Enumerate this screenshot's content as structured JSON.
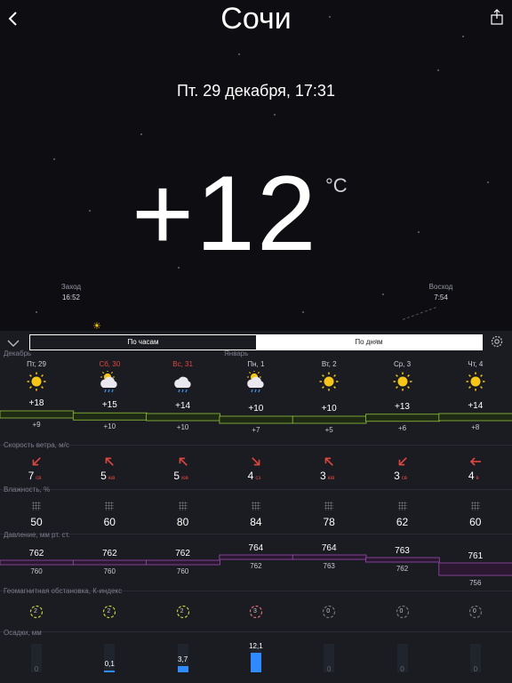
{
  "header": {
    "city": "Сочи",
    "datetime": "Пт. 29 декабря, 17:31",
    "temperature": "+12",
    "unit": "°C",
    "sunset_label": "Заход",
    "sunset_time": "16:52",
    "sunrise_label": "Восход",
    "sunrise_time": "7:54"
  },
  "tabs": {
    "hourly": "По часам",
    "daily": "По дням",
    "active": "hourly"
  },
  "months": {
    "first": "Декабрь",
    "second": "Январь"
  },
  "days": [
    {
      "name": "Пт, 29",
      "weekend": false,
      "icon": "sun-icon",
      "day": "+18",
      "night": "+9",
      "wind": "7",
      "dir": "св",
      "arrow": "arrow-down-left-icon",
      "humidity": "50",
      "pressure_day": "762",
      "pressure_night": "760",
      "kp": "2",
      "precip": "0",
      "precip_val": 0
    },
    {
      "name": "Сб, 30",
      "weekend": true,
      "icon": "rain-cloud-sun-icon",
      "day": "+15",
      "night": "+10",
      "wind": "5",
      "dir": "юв",
      "arrow": "arrow-up-left-icon",
      "humidity": "60",
      "pressure_day": "762",
      "pressure_night": "760",
      "kp": "2",
      "precip": "0,1",
      "precip_val": 0.1
    },
    {
      "name": "Вс, 31",
      "weekend": true,
      "icon": "rain-cloud-icon",
      "day": "+14",
      "night": "+10",
      "wind": "5",
      "dir": "юв",
      "arrow": "arrow-up-left-icon",
      "humidity": "80",
      "pressure_day": "762",
      "pressure_night": "760",
      "kp": "2",
      "precip": "3,7",
      "precip_val": 3.7
    },
    {
      "name": "Пн, 1",
      "weekend": false,
      "icon": "rain-cloud-sun-icon",
      "day": "+10",
      "night": "+7",
      "wind": "4",
      "dir": "сз",
      "arrow": "arrow-down-right-icon",
      "humidity": "84",
      "pressure_day": "764",
      "pressure_night": "762",
      "kp": "3",
      "precip": "12,1",
      "precip_val": 12.1
    },
    {
      "name": "Вт, 2",
      "weekend": false,
      "icon": "sun-icon",
      "day": "+10",
      "night": "+5",
      "wind": "3",
      "dir": "юв",
      "arrow": "arrow-up-left-icon",
      "humidity": "78",
      "pressure_day": "764",
      "pressure_night": "763",
      "kp": "0",
      "precip": "0",
      "precip_val": 0
    },
    {
      "name": "Ср, 3",
      "weekend": false,
      "icon": "sun-icon",
      "day": "+13",
      "night": "+6",
      "wind": "3",
      "dir": "св",
      "arrow": "arrow-down-left-icon",
      "humidity": "62",
      "pressure_day": "763",
      "pressure_night": "762",
      "kp": "0",
      "precip": "0",
      "precip_val": 0
    },
    {
      "name": "Чт, 4",
      "weekend": false,
      "icon": "sun-icon",
      "day": "+14",
      "night": "+8",
      "wind": "4",
      "dir": "в",
      "arrow": "arrow-left-icon",
      "humidity": "60",
      "pressure_day": "761",
      "pressure_night": "756",
      "kp": "0",
      "precip": "0",
      "precip_val": 0
    }
  ],
  "sections": {
    "wind": "Скорость ветра, м/с",
    "humidity": "Влажность, %",
    "pressure": "Давление, мм рт. ст.",
    "geomagnetic": "Геомагнитная обстановка, К-индекс",
    "precip": "Осадки, мм"
  },
  "colors": {
    "accent_red": "#e0483f",
    "temp_band": "#8fc43a",
    "pressure_band": "#9c4bb0",
    "rain": "#2f8bff",
    "sun": "#f5c518"
  }
}
